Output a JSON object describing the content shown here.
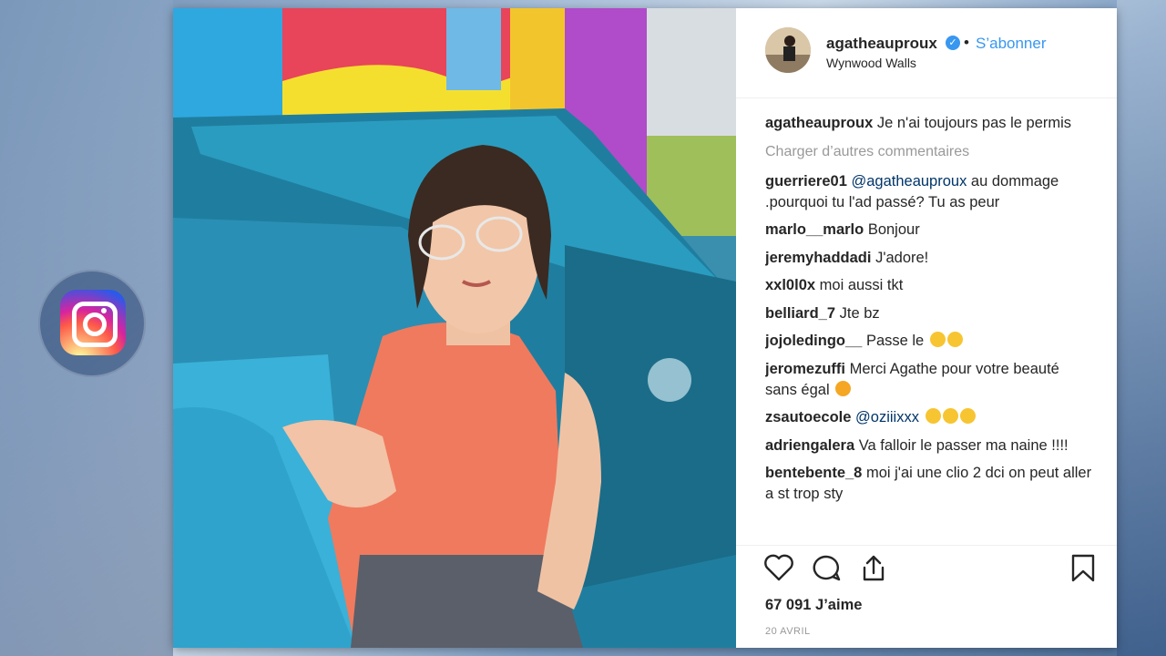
{
  "post": {
    "username": "agatheauproux",
    "follow_label": "S’abonner",
    "separator": "•",
    "location": "Wynwood Walls",
    "caption_user": "agatheauproux",
    "caption_text": "Je n'ai toujours pas le permis",
    "load_more_label": "Charger d’autres commentaires",
    "comments": [
      {
        "user": "guerriere01",
        "mention": "@agatheauproux",
        "text": "au dommage .pourquoi tu l'ad passé? Tu as peur"
      },
      {
        "user": "marlo__marlo",
        "text": "Bonjour"
      },
      {
        "user": "jeremyhaddadi",
        "text": "J'adore!"
      },
      {
        "user": "xxl0l0x",
        "text": "moi aussi tkt"
      },
      {
        "user": "belliard_7",
        "text": "Jte bz"
      },
      {
        "user": "jojoledingo__",
        "text": "Passe le"
      },
      {
        "user": "jeromezuffi",
        "text": "Merci Agathe pour votre beauté sans égal"
      },
      {
        "user": "zsautoecole",
        "mention": "@oziiixxx",
        "text": ""
      },
      {
        "user": "adriengalera",
        "text": "Va falloir le passer ma naine !!!!"
      },
      {
        "user": "bentebente_8",
        "text": "moi j'ai une clio 2 dci on peut aller a st trop sty"
      }
    ],
    "likes_label": "67 091 J’aime",
    "date_label": "20 AVRIL"
  },
  "icons": {
    "like": "heart-icon",
    "comment": "comment-bubble-icon",
    "share": "share-icon",
    "save": "bookmark-icon",
    "verified": "verified-badge-icon",
    "brand": "instagram-logo-icon"
  },
  "colors": {
    "accent": "#3897f0",
    "mention": "#003569",
    "muted": "#999999",
    "text": "#262626"
  }
}
